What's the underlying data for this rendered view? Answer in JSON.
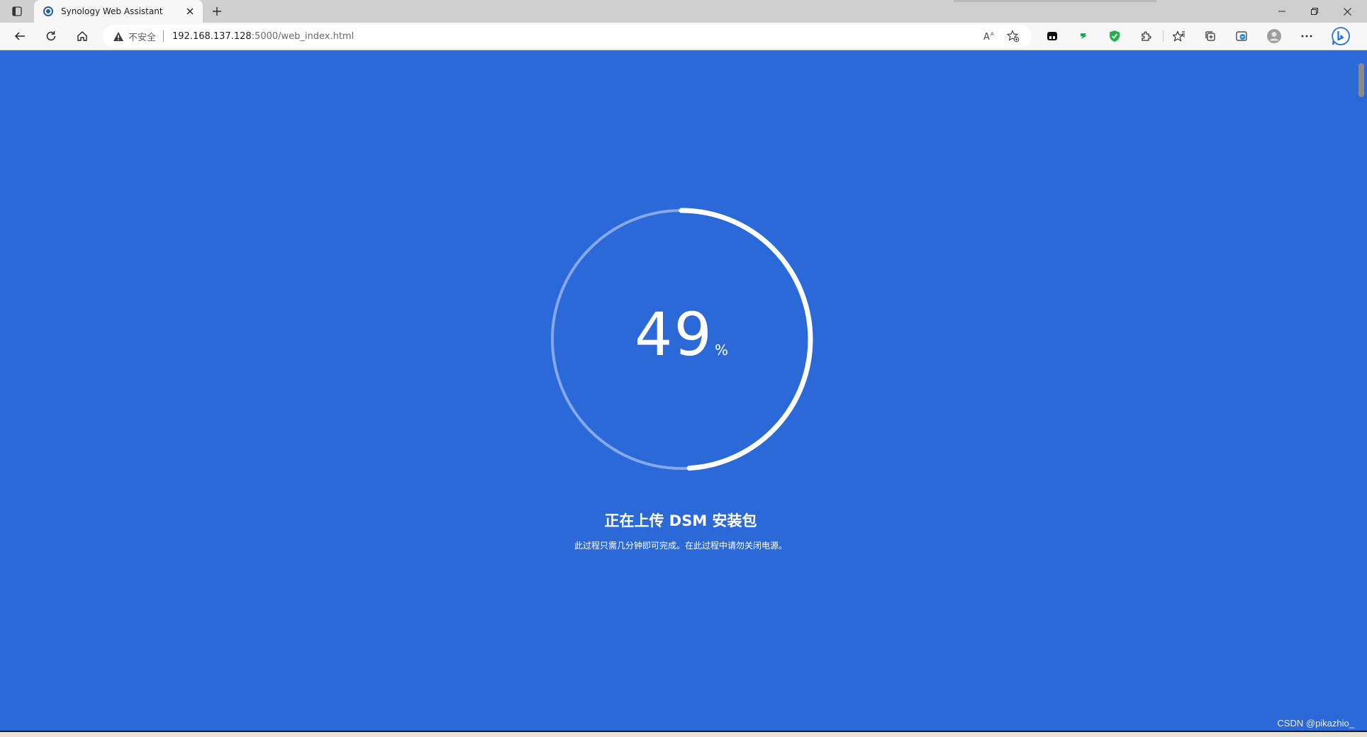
{
  "browser": {
    "tab": {
      "title": "Synology Web Assistant",
      "favicon": "synology-icon"
    },
    "address": {
      "security_label": "不安全",
      "url_host": "192.168.137.128",
      "url_rest": ":5000/web_index.html"
    }
  },
  "page": {
    "progress": {
      "value": "49",
      "unit": "%",
      "fraction": 0.49
    },
    "status_title": "正在上传 DSM 安装包",
    "status_description": "此过程只需几分钟即可完成。在此过程中请勿关闭电源。",
    "background_color": "#2b69d8"
  },
  "watermark": "CSDN @pikazhio_"
}
